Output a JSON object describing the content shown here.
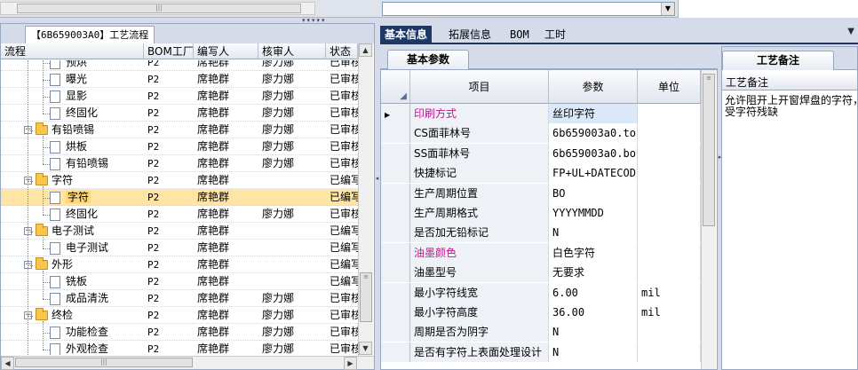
{
  "top": {
    "combo_value": "",
    "combo_arrow": "▼"
  },
  "left": {
    "tab_label": "【6B659003A0】工艺流程",
    "columns": [
      "流程",
      "BOM工厂",
      "编写人",
      "核审人",
      "状态"
    ],
    "rows": [
      {
        "name": "预烘",
        "bom": "P2",
        "writer": "席艳群",
        "reviewer": "廖力娜",
        "status": "已审核",
        "type": "leaf",
        "selected": false
      },
      {
        "name": "曝光",
        "bom": "P2",
        "writer": "席艳群",
        "reviewer": "廖力娜",
        "status": "已审核",
        "type": "leaf",
        "selected": false
      },
      {
        "name": "显影",
        "bom": "P2",
        "writer": "席艳群",
        "reviewer": "廖力娜",
        "status": "已审核",
        "type": "leaf",
        "selected": false
      },
      {
        "name": "终固化",
        "bom": "P2",
        "writer": "席艳群",
        "reviewer": "廖力娜",
        "status": "已审核",
        "type": "leaf",
        "selected": false
      },
      {
        "name": "有铅喷锡",
        "bom": "P2",
        "writer": "席艳群",
        "reviewer": "廖力娜",
        "status": "已审核",
        "type": "group",
        "selected": false
      },
      {
        "name": "烘板",
        "bom": "P2",
        "writer": "席艳群",
        "reviewer": "廖力娜",
        "status": "已审核",
        "type": "leaf",
        "selected": false
      },
      {
        "name": "有铅喷锡",
        "bom": "P2",
        "writer": "席艳群",
        "reviewer": "廖力娜",
        "status": "已审核",
        "type": "leaf",
        "selected": false
      },
      {
        "name": "字符",
        "bom": "P2",
        "writer": "席艳群",
        "reviewer": "",
        "status": "已编写",
        "type": "group",
        "selected": false
      },
      {
        "name": "字符",
        "bom": "P2",
        "writer": "席艳群",
        "reviewer": "",
        "status": "已编写",
        "type": "leaf",
        "selected": true
      },
      {
        "name": "终固化",
        "bom": "P2",
        "writer": "席艳群",
        "reviewer": "廖力娜",
        "status": "已审核",
        "type": "leaf",
        "selected": false
      },
      {
        "name": "电子测试",
        "bom": "P2",
        "writer": "席艳群",
        "reviewer": "",
        "status": "已编写",
        "type": "group",
        "selected": false
      },
      {
        "name": "电子测试",
        "bom": "P2",
        "writer": "席艳群",
        "reviewer": "",
        "status": "已编写",
        "type": "leaf",
        "selected": false
      },
      {
        "name": "外形",
        "bom": "P2",
        "writer": "席艳群",
        "reviewer": "",
        "status": "已编写",
        "type": "group",
        "selected": false
      },
      {
        "name": "铣板",
        "bom": "P2",
        "writer": "席艳群",
        "reviewer": "",
        "status": "已编写",
        "type": "leaf",
        "selected": false
      },
      {
        "name": "成品清洗",
        "bom": "P2",
        "writer": "席艳群",
        "reviewer": "廖力娜",
        "status": "已审核",
        "type": "leaf",
        "selected": false
      },
      {
        "name": "终检",
        "bom": "P2",
        "writer": "席艳群",
        "reviewer": "廖力娜",
        "status": "已审核",
        "type": "group",
        "selected": false
      },
      {
        "name": "功能检查",
        "bom": "P2",
        "writer": "席艳群",
        "reviewer": "廖力娜",
        "status": "已审核",
        "type": "leaf",
        "selected": false
      },
      {
        "name": "外观检查",
        "bom": "P2",
        "writer": "席艳群",
        "reviewer": "廖力娜",
        "status": "已审核",
        "type": "leaf",
        "selected": false
      }
    ]
  },
  "right": {
    "tabs": [
      "基本信息",
      "拓展信息",
      "BOM",
      "工时"
    ],
    "active_tab": 0,
    "sub_tab": "基本参数",
    "columns": [
      "项目",
      "参数",
      "单位"
    ],
    "rows": [
      {
        "item": "印刷方式",
        "value": "丝印字符",
        "unit": "",
        "highlight": true,
        "current": true
      },
      {
        "item": "CS面菲林号",
        "value": "6b659003a0.to",
        "unit": "",
        "highlight": false,
        "current": false
      },
      {
        "item": "SS面菲林号",
        "value": "6b659003a0.bo",
        "unit": "",
        "highlight": false,
        "current": false
      },
      {
        "item": "快捷标记",
        "value": "FP+UL+DATECODE",
        "unit": "",
        "highlight": false,
        "current": false
      },
      {
        "item": "生产周期位置",
        "value": "BO",
        "unit": "",
        "highlight": false,
        "current": false
      },
      {
        "item": "生产周期格式",
        "value": "YYYYMMDD",
        "unit": "",
        "highlight": false,
        "current": false
      },
      {
        "item": "是否加无铅标记",
        "value": "N",
        "unit": "",
        "highlight": false,
        "current": false
      },
      {
        "item": "油墨颜色",
        "value": "白色字符",
        "unit": "",
        "highlight": true,
        "current": false
      },
      {
        "item": "油墨型号",
        "value": "无要求",
        "unit": "",
        "highlight": false,
        "current": false
      },
      {
        "item": "最小字符线宽",
        "value": "6.00",
        "unit": "mil",
        "highlight": false,
        "current": false
      },
      {
        "item": "最小字符高度",
        "value": "36.00",
        "unit": "mil",
        "highlight": false,
        "current": false
      },
      {
        "item": "周期是否为阴字",
        "value": "N",
        "unit": "",
        "highlight": false,
        "current": false
      },
      {
        "item": "是否有字符上表面处理设计",
        "value": "N",
        "unit": "",
        "highlight": false,
        "current": false
      }
    ],
    "colors": {
      "highlight": "#c0178f",
      "accent": "#1e3866"
    }
  },
  "notes": {
    "tab": "工艺备注",
    "header": "工艺备注",
    "lines": [
      "允许阻开上开窗焊盘的字符，",
      "受字符残缺"
    ]
  },
  "icons": {
    "combo": "chevron-down-icon",
    "folder": "folder-icon",
    "doc": "document-icon"
  }
}
